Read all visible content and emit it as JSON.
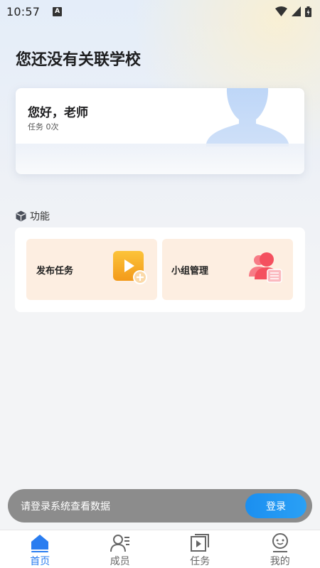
{
  "status_bar": {
    "time": "10:57",
    "notification_icon": "A"
  },
  "page_title": "您还没有关联学校",
  "teacher_card": {
    "greeting": "您好，老师",
    "task_count": "任务 0次"
  },
  "features": {
    "section_title": "功能",
    "items": [
      {
        "label": "发布任务",
        "icon": "video-add-icon",
        "color": "#f7a51e"
      },
      {
        "label": "小组管理",
        "icon": "group-manage-icon",
        "color": "#f45d6b"
      }
    ]
  },
  "login_bar": {
    "prompt": "请登录系统查看数据",
    "button_label": "登录"
  },
  "bottom_nav": {
    "items": [
      {
        "label": "首页",
        "icon": "home-icon",
        "active": true
      },
      {
        "label": "成员",
        "icon": "members-icon",
        "active": false
      },
      {
        "label": "任务",
        "icon": "task-icon",
        "active": false
      },
      {
        "label": "我的",
        "icon": "profile-icon",
        "active": false
      }
    ]
  },
  "colors": {
    "accent": "#2a7df0",
    "feature_tile_bg": "#fdeee1",
    "login_bar_bg": "#8c8c8c"
  }
}
